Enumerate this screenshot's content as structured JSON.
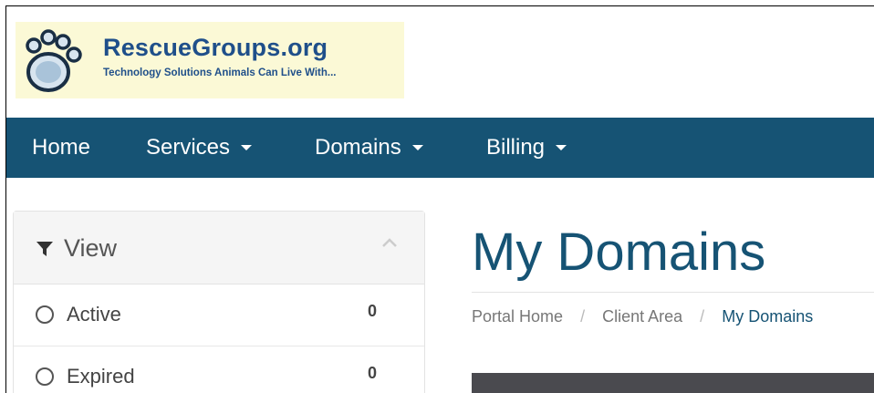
{
  "logo": {
    "title": "RescueGroups.org",
    "tagline": "Technology Solutions Animals Can Live With...",
    "bg_color": "#fbf9d6",
    "text_color": "#1f4f8a"
  },
  "navbar": {
    "bg_color": "#165374",
    "items": [
      {
        "label": "Home",
        "dropdown": false
      },
      {
        "label": "Services",
        "dropdown": true
      },
      {
        "label": "Domains",
        "dropdown": true
      },
      {
        "label": "Billing",
        "dropdown": true
      }
    ]
  },
  "sidebar": {
    "title": "View",
    "icon": "filter-icon",
    "collapse_icon": "chevron-up-icon",
    "rows": [
      {
        "label": "Active",
        "count": "0"
      },
      {
        "label": "Expired",
        "count": "0"
      }
    ]
  },
  "main": {
    "title": "My Domains",
    "breadcrumb": {
      "items": [
        "Portal Home",
        "Client Area"
      ],
      "separator": "/",
      "current": "My Domains"
    }
  }
}
